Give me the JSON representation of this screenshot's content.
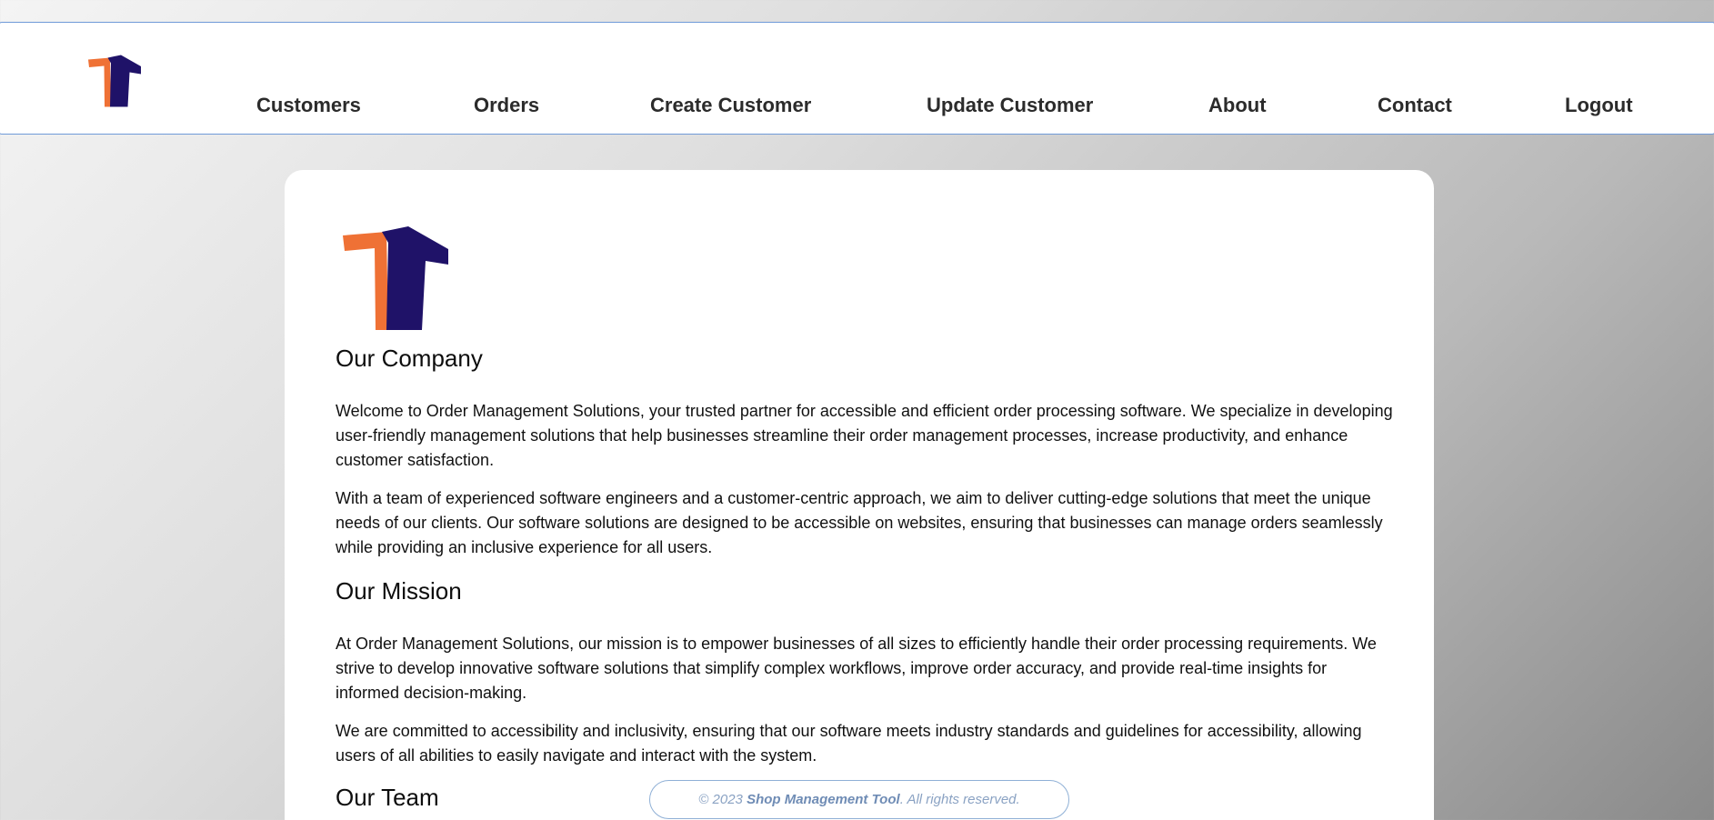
{
  "nav": {
    "links": [
      {
        "label": "Customers"
      },
      {
        "label": "Orders"
      },
      {
        "label": "Create Customer"
      },
      {
        "label": "Update Customer"
      },
      {
        "label": "About"
      },
      {
        "label": "Contact"
      },
      {
        "label": "Logout"
      }
    ],
    "logo_icon": "t-logo-icon"
  },
  "sections": {
    "company": {
      "heading": "Our Company",
      "p1": "Welcome to Order Management Solutions, your trusted partner for accessible and efficient order processing software. We specialize in developing user-friendly management solutions that help businesses streamline their order management processes, increase productivity, and enhance customer satisfaction.",
      "p2": "With a team of experienced software engineers and a customer-centric approach, we aim to deliver cutting-edge solutions that meet the unique needs of our clients. Our software solutions are designed to be accessible on websites, ensuring that businesses can manage orders seamlessly while providing an inclusive experience for all users."
    },
    "mission": {
      "heading": "Our Mission",
      "p1": "At Order Management Solutions, our mission is to empower businesses of all sizes to efficiently handle their order processing requirements. We strive to develop innovative software solutions that simplify complex workflows, improve order accuracy, and provide real-time insights for informed decision-making.",
      "p2": "We are committed to accessibility and inclusivity, ensuring that our software meets industry standards and guidelines for accessibility, allowing users of all abilities to easily navigate and interact with the system."
    },
    "team": {
      "heading": "Our Team"
    }
  },
  "footer": {
    "prefix": "© 2023 ",
    "brand": "Shop Management Tool",
    "suffix": ". All rights reserved."
  },
  "colors": {
    "logo_orange": "#ef7135",
    "logo_navy": "#1f1268",
    "nav_border": "#6f9ad8"
  }
}
